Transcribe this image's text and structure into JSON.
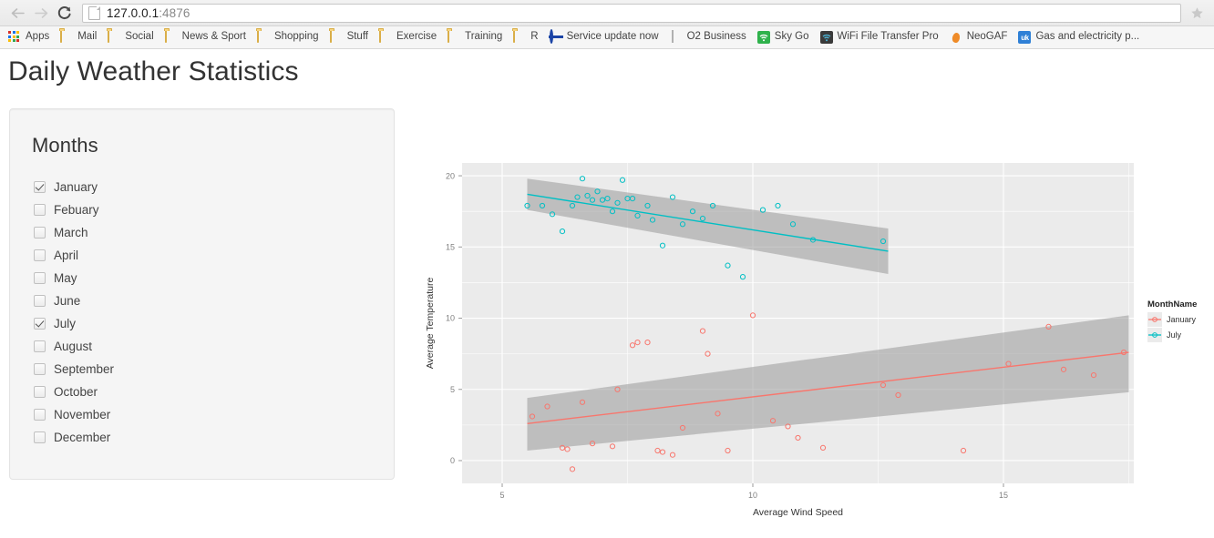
{
  "browser": {
    "back_icon": "back-arrow-icon",
    "forward_icon": "forward-arrow-icon",
    "reload_icon": "reload-icon",
    "page_icon": "page-document-icon",
    "url_host": "127.0.0.1",
    "url_port": ":4876",
    "url_full": "127.0.0.1:4876",
    "star_icon": "bookmark-star-icon",
    "bookmarks": [
      {
        "label": "Apps",
        "icon": "apps-grid-icon"
      },
      {
        "label": "Mail",
        "icon": "folder-icon"
      },
      {
        "label": "Social",
        "icon": "folder-icon"
      },
      {
        "label": "News & Sport",
        "icon": "folder-icon"
      },
      {
        "label": "Shopping",
        "icon": "folder-icon"
      },
      {
        "label": "Stuff",
        "icon": "folder-icon"
      },
      {
        "label": "Exercise",
        "icon": "folder-icon"
      },
      {
        "label": "Training",
        "icon": "folder-icon"
      },
      {
        "label": "R",
        "icon": "folder-icon"
      },
      {
        "label": "Service update now",
        "icon": "tfl-roundel-icon"
      },
      {
        "label": "O2 Business",
        "icon": "document-icon"
      },
      {
        "label": "Sky Go",
        "icon": "wifi-green-icon"
      },
      {
        "label": "WiFi File Transfer Pro",
        "icon": "wifi-dark-icon"
      },
      {
        "label": "NeoGAF",
        "icon": "neogaf-icon"
      },
      {
        "label": "Gas and electricity p...",
        "icon": "uk-switch-icon"
      }
    ]
  },
  "page": {
    "title": "Daily Weather Statistics"
  },
  "sidebar": {
    "heading": "Months",
    "months": [
      {
        "label": "January",
        "checked": true
      },
      {
        "label": "Febuary",
        "checked": false
      },
      {
        "label": "March",
        "checked": false
      },
      {
        "label": "April",
        "checked": false
      },
      {
        "label": "May",
        "checked": false
      },
      {
        "label": "June",
        "checked": false
      },
      {
        "label": "July",
        "checked": true
      },
      {
        "label": "August",
        "checked": false
      },
      {
        "label": "September",
        "checked": false
      },
      {
        "label": "October",
        "checked": false
      },
      {
        "label": "November",
        "checked": false
      },
      {
        "label": "December",
        "checked": false
      }
    ]
  },
  "chart_data": {
    "type": "scatter",
    "title": "",
    "xlabel": "Average Wind Speed",
    "ylabel": "Average Temperature",
    "xlim": [
      4.2,
      17.6
    ],
    "ylim": [
      -1.6,
      20.9
    ],
    "xticks": [
      5,
      10,
      15
    ],
    "yticks": [
      0,
      5,
      10,
      15,
      20
    ],
    "grid": true,
    "panel_bg": "#EBEBEB",
    "grid_color": "#FFFFFF",
    "ribbon_color": "#999999",
    "legend": {
      "title": "MonthName",
      "position": "right",
      "entries": [
        {
          "name": "January",
          "color": "#F8766D"
        },
        {
          "name": "July",
          "color": "#00BFC4"
        }
      ]
    },
    "series": [
      {
        "name": "January",
        "color": "#F8766D",
        "points": [
          [
            5.6,
            3.1
          ],
          [
            5.9,
            3.8
          ],
          [
            6.2,
            0.9
          ],
          [
            6.3,
            0.8
          ],
          [
            6.4,
            -0.6
          ],
          [
            6.6,
            4.1
          ],
          [
            6.8,
            1.2
          ],
          [
            7.2,
            1.0
          ],
          [
            7.3,
            5.0
          ],
          [
            7.6,
            8.1
          ],
          [
            7.7,
            8.3
          ],
          [
            7.9,
            8.3
          ],
          [
            8.1,
            0.7
          ],
          [
            8.2,
            0.6
          ],
          [
            8.4,
            0.4
          ],
          [
            8.6,
            2.3
          ],
          [
            9.0,
            9.1
          ],
          [
            9.1,
            7.5
          ],
          [
            9.3,
            3.3
          ],
          [
            9.5,
            0.7
          ],
          [
            10.0,
            10.2
          ],
          [
            10.4,
            2.8
          ],
          [
            10.7,
            2.4
          ],
          [
            10.9,
            1.6
          ],
          [
            11.4,
            0.9
          ],
          [
            12.6,
            5.3
          ],
          [
            12.9,
            4.6
          ],
          [
            14.2,
            0.7
          ],
          [
            15.1,
            6.8
          ],
          [
            15.9,
            9.4
          ],
          [
            16.2,
            6.4
          ],
          [
            16.8,
            6.0
          ],
          [
            17.4,
            7.6
          ]
        ],
        "fit": {
          "x0": 5.5,
          "y0": 2.6,
          "x1": 17.5,
          "y1": 7.6
        },
        "ribbon": {
          "x0": 5.5,
          "lo0": 0.7,
          "hi0": 4.4,
          "x1": 17.5,
          "lo1": 4.8,
          "hi1": 10.2
        }
      },
      {
        "name": "July",
        "color": "#00BFC4",
        "points": [
          [
            5.5,
            17.9
          ],
          [
            5.8,
            17.9
          ],
          [
            6.0,
            17.3
          ],
          [
            6.2,
            16.1
          ],
          [
            6.4,
            17.9
          ],
          [
            6.5,
            18.5
          ],
          [
            6.6,
            19.8
          ],
          [
            6.7,
            18.6
          ],
          [
            6.8,
            18.3
          ],
          [
            6.9,
            18.9
          ],
          [
            7.0,
            18.3
          ],
          [
            7.1,
            18.4
          ],
          [
            7.2,
            17.5
          ],
          [
            7.3,
            18.1
          ],
          [
            7.4,
            19.7
          ],
          [
            7.5,
            18.4
          ],
          [
            7.6,
            18.4
          ],
          [
            7.7,
            17.2
          ],
          [
            7.9,
            17.9
          ],
          [
            8.0,
            16.9
          ],
          [
            8.2,
            15.1
          ],
          [
            8.4,
            18.5
          ],
          [
            8.6,
            16.6
          ],
          [
            8.8,
            17.5
          ],
          [
            9.0,
            17.0
          ],
          [
            9.2,
            17.9
          ],
          [
            9.5,
            13.7
          ],
          [
            9.8,
            12.9
          ],
          [
            10.2,
            17.6
          ],
          [
            10.5,
            17.9
          ],
          [
            10.8,
            16.6
          ],
          [
            11.2,
            15.5
          ],
          [
            12.6,
            15.4
          ]
        ],
        "fit": {
          "x0": 5.5,
          "y0": 18.7,
          "x1": 12.7,
          "y1": 14.7
        },
        "ribbon": {
          "x0": 5.5,
          "lo0": 17.6,
          "hi0": 19.8,
          "x1": 12.7,
          "lo1": 13.1,
          "hi1": 16.3
        }
      }
    ]
  }
}
